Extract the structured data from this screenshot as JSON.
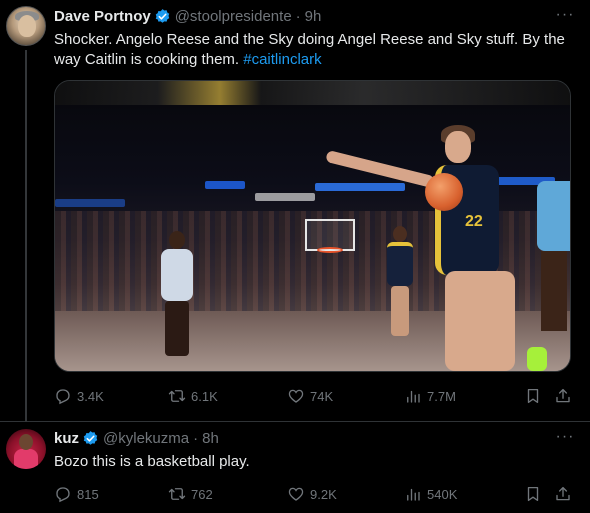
{
  "tweets": [
    {
      "author_name": "Dave Portnoy",
      "handle": "@stoolpresidente",
      "separator": "·",
      "time": "9h",
      "verified": true,
      "text_main": "Shocker.   Angelo Reese and the Sky doing Angel Reese and Sky stuff.   By the way Caitlin is cooking them. ",
      "hashtag": "#caitlinclark",
      "media_jersey_number": "22",
      "stats": {
        "replies": "3.4K",
        "reposts": "6.1K",
        "likes": "74K",
        "views": "7.7M"
      }
    },
    {
      "author_name": "kuz",
      "handle": "@kylekuzma",
      "separator": "·",
      "time": "8h",
      "verified": true,
      "text_main": "Bozo this is a basketball play.",
      "stats": {
        "replies": "815",
        "reposts": "762",
        "likes": "9.2K",
        "views": "540K"
      }
    }
  ],
  "more_glyph": "···",
  "colors": {
    "background": "#000000",
    "text": "#e7e9ea",
    "muted": "#71767b",
    "accent": "#1d9bf0",
    "verified": "#1d9bf0",
    "divider": "#2f3336"
  },
  "icons": [
    "verified-badge-icon",
    "more-icon",
    "reply-icon",
    "repost-icon",
    "like-icon",
    "views-icon",
    "bookmark-icon",
    "share-icon"
  ]
}
